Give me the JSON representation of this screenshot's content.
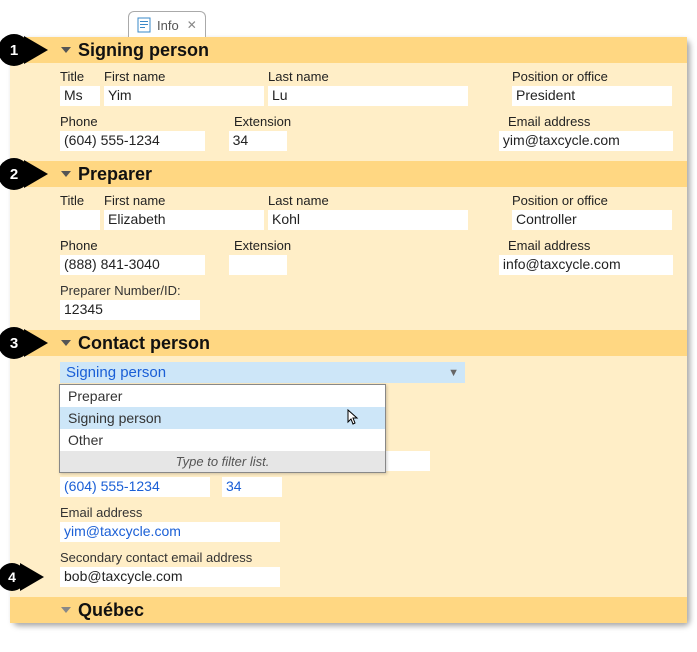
{
  "tab": {
    "label": "Info"
  },
  "sections": {
    "signing": {
      "header": "Signing person",
      "title_label": "Title",
      "title_value": "Ms",
      "first_label": "First name",
      "first_value": "Yim",
      "last_label": "Last name",
      "last_value": "Lu",
      "pos_label": "Position or office",
      "pos_value": "President",
      "phone_label": "Phone",
      "phone_value": "(604) 555-1234",
      "ext_label": "Extension",
      "ext_value": "34",
      "email_label": "Email address",
      "email_value": "yim@taxcycle.com"
    },
    "preparer": {
      "header": "Preparer",
      "title_label": "Title",
      "title_value": "",
      "first_label": "First name",
      "first_value": "Elizabeth",
      "last_label": "Last name",
      "last_value": "Kohl",
      "pos_label": "Position or office",
      "pos_value": "Controller",
      "phone_label": "Phone",
      "phone_value": "(888) 841-3040",
      "ext_label": "Extension",
      "ext_value": "",
      "email_label": "Email address",
      "email_value": "info@taxcycle.com",
      "id_label": "Preparer Number/ID:",
      "id_value": "12345"
    },
    "contact": {
      "header": "Contact person",
      "dropdown": {
        "selected": "Signing person",
        "options": [
          "Preparer",
          "Signing person",
          "Other"
        ],
        "hint": "Type to filter list."
      },
      "phone_value": "(604) 555-1234",
      "ext_value": "34",
      "email_label": "Email address",
      "email_value": "yim@taxcycle.com",
      "secondary_label": "Secondary contact email address",
      "secondary_value": "bob@taxcycle.com"
    },
    "quebec": {
      "header": "Québec"
    }
  },
  "badges": {
    "b1": "1",
    "b2": "2",
    "b3": "3",
    "b4": "4"
  }
}
